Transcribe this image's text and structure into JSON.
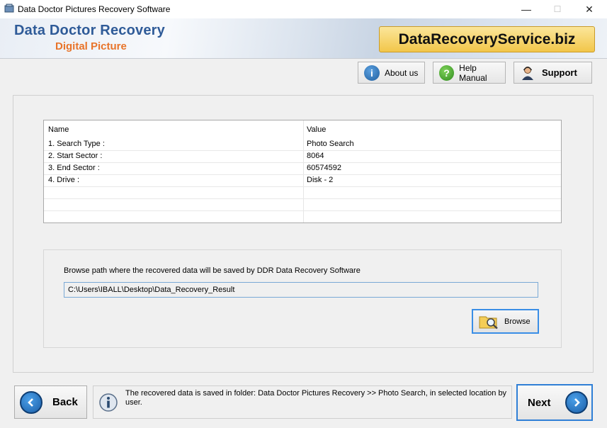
{
  "window": {
    "title": "Data Doctor Pictures Recovery Software",
    "minimize_glyph": "—",
    "maximize_glyph": "☐",
    "close_glyph": "✕"
  },
  "header": {
    "brand_title": "Data Doctor Recovery",
    "brand_subtitle": "Digital Picture",
    "site_badge": "DataRecoveryService.biz"
  },
  "toolbar": {
    "about_label": "About us",
    "help_label": "Help Manual",
    "support_label": "Support"
  },
  "table": {
    "columns": [
      "Name",
      "Value"
    ],
    "rows": [
      {
        "name": "1. Search Type :",
        "value": "Photo Search"
      },
      {
        "name": "2. Start Sector :",
        "value": "8064"
      },
      {
        "name": "3. End Sector :",
        "value": "60574592"
      },
      {
        "name": "4. Drive :",
        "value": "Disk - 2"
      }
    ]
  },
  "browse": {
    "label": "Browse path where the recovered data will be saved by DDR Data Recovery Software",
    "path_value": "C:\\Users\\IBALL\\Desktop\\Data_Recovery_Result",
    "button_label": "Browse"
  },
  "footer": {
    "back_label": "Back",
    "status_text": "The recovered data is saved in folder: Data Doctor Pictures Recovery  >> Photo Search, in selected location by user.",
    "next_label": "Next"
  },
  "colors": {
    "brand_blue": "#2f5b98",
    "brand_orange": "#e8742a",
    "badge_gold": "#f2c64a",
    "focus_blue": "#3a8ee6"
  }
}
